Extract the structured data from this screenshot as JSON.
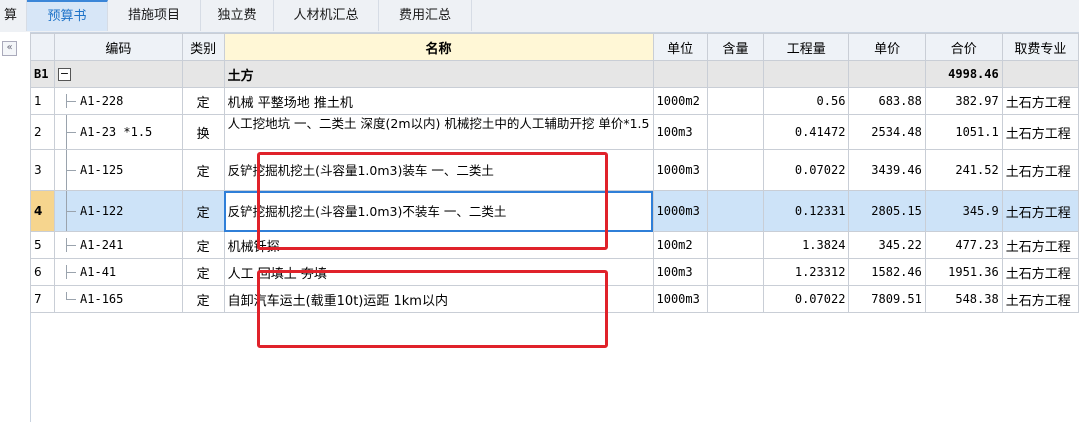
{
  "tabs": [
    {
      "label": "预算书",
      "active": true
    },
    {
      "label": "措施项目"
    },
    {
      "label": "独立费"
    },
    {
      "label": "人材机汇总"
    },
    {
      "label": "费用汇总"
    }
  ],
  "side_tab_fragment": "算",
  "collapse_glyph": "«",
  "columns": [
    "编码",
    "类别",
    "名称",
    "单位",
    "含量",
    "工程量",
    "单价",
    "合价",
    "取费专业"
  ],
  "group": {
    "id": "B1",
    "toggle": "−",
    "name": "土方",
    "total": "4998.46"
  },
  "rows": [
    {
      "n": "1",
      "code": "A1-228",
      "type": "定",
      "name": "机械 平整场地 推土机",
      "unit": "1000m2",
      "qty": "0.56",
      "price": "683.88",
      "total": "382.97",
      "spec": "土石方工程"
    },
    {
      "n": "2",
      "code": "A1-23 *1.5",
      "type": "换",
      "name": "人工挖地坑 一、二类土 深度(2m以内) 机械挖土中的人工辅助开挖 单价*1.5",
      "unit": "100m3",
      "qty": "0.41472",
      "price": "2534.48",
      "total": "1051.1",
      "spec": "土石方工程"
    },
    {
      "n": "3",
      "code": "A1-125",
      "type": "定",
      "name": "反铲挖掘机挖土(斗容量1.0m3)装车 一、二类土",
      "unit": "1000m3",
      "qty": "0.07022",
      "price": "3439.46",
      "total": "241.52",
      "spec": "土石方工程"
    },
    {
      "n": "4",
      "code": "A1-122",
      "type": "定",
      "name": "反铲挖掘机挖土(斗容量1.0m3)不装车 一、二类土",
      "unit": "1000m3",
      "qty": "0.12331",
      "price": "2805.15",
      "total": "345.9",
      "spec": "土石方工程"
    },
    {
      "n": "5",
      "code": "A1-241",
      "type": "定",
      "name": "机械钎探",
      "unit": "100m2",
      "qty": "1.3824",
      "price": "345.22",
      "total": "477.23",
      "spec": "土石方工程"
    },
    {
      "n": "6",
      "code": "A1-41",
      "type": "定",
      "name": "人工 回填土 夯填",
      "unit": "100m3",
      "qty": "1.23312",
      "price": "1582.46",
      "total": "1951.36",
      "spec": "土石方工程"
    },
    {
      "n": "7",
      "code": "A1-165",
      "type": "定",
      "name": "自卸汽车运土(载重10t)运距 1km以内",
      "unit": "1000m3",
      "qty": "0.07022",
      "price": "7809.51",
      "total": "548.38",
      "spec": "土石方工程"
    }
  ],
  "colors": {
    "highlight": "#e0222a",
    "selection": "#2f7fd8",
    "active_tab": "#1e73c8"
  }
}
